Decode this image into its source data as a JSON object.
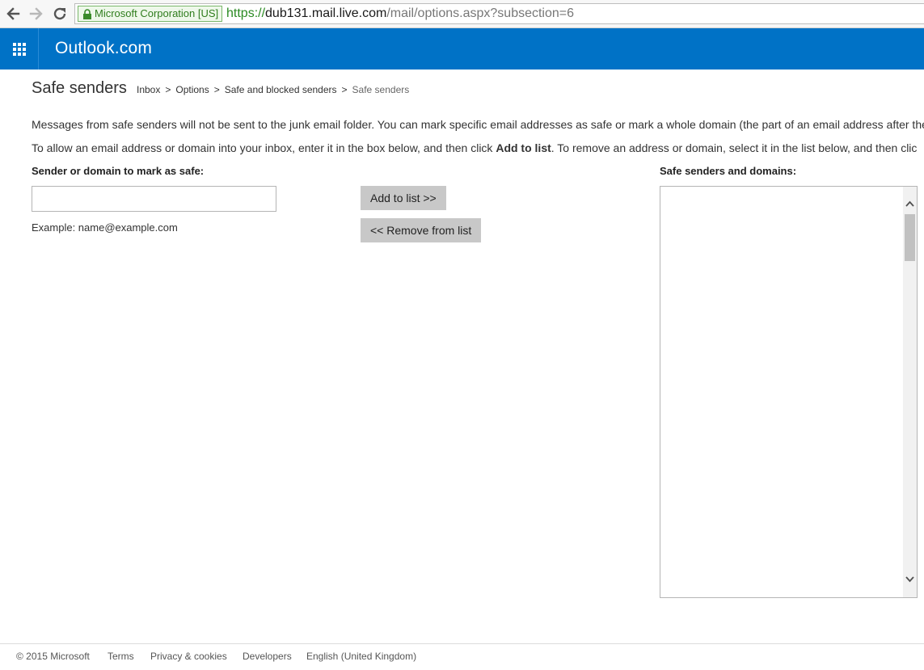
{
  "browser": {
    "ev_badge": "Microsoft Corporation [US]",
    "url_scheme": "https://",
    "url_host": "dub131.mail.live.com",
    "url_path": "/mail/options.aspx?subsection=6",
    "back_icon": "back-arrow-icon",
    "forward_icon": "forward-arrow-icon",
    "reload_icon": "reload-icon",
    "lock_icon": "lock-icon"
  },
  "header": {
    "app_launcher_icon": "waffle-grid-icon",
    "brand": "Outlook.com",
    "color": "#0072c6"
  },
  "page": {
    "title": "Safe senders",
    "breadcrumb": {
      "items": [
        "Inbox",
        "Options",
        "Safe and blocked senders"
      ],
      "current": "Safe senders",
      "separator": ">"
    },
    "description_1": "Messages from safe senders will not be sent to the junk email folder. You can mark specific email addresses as safe or mark a whole domain (the part of an email address after the",
    "description_2_pre": "To allow an email address or domain into your inbox, enter it in the box below, and then click ",
    "description_2_bold": "Add to list",
    "description_2_post": ". To remove an address or domain, select it in the list below, and then clic"
  },
  "form": {
    "input_label": "Sender or domain to mark as safe:",
    "input_value": "",
    "example": "Example: name@example.com",
    "add_button": "Add to list >>",
    "remove_button": "<< Remove from list",
    "list_label": "Safe senders and domains:",
    "list_items": []
  },
  "footer": {
    "copyright": "© 2015 Microsoft",
    "terms": "Terms",
    "privacy": "Privacy & cookies",
    "developers": "Developers",
    "language": "English (United Kingdom)"
  }
}
